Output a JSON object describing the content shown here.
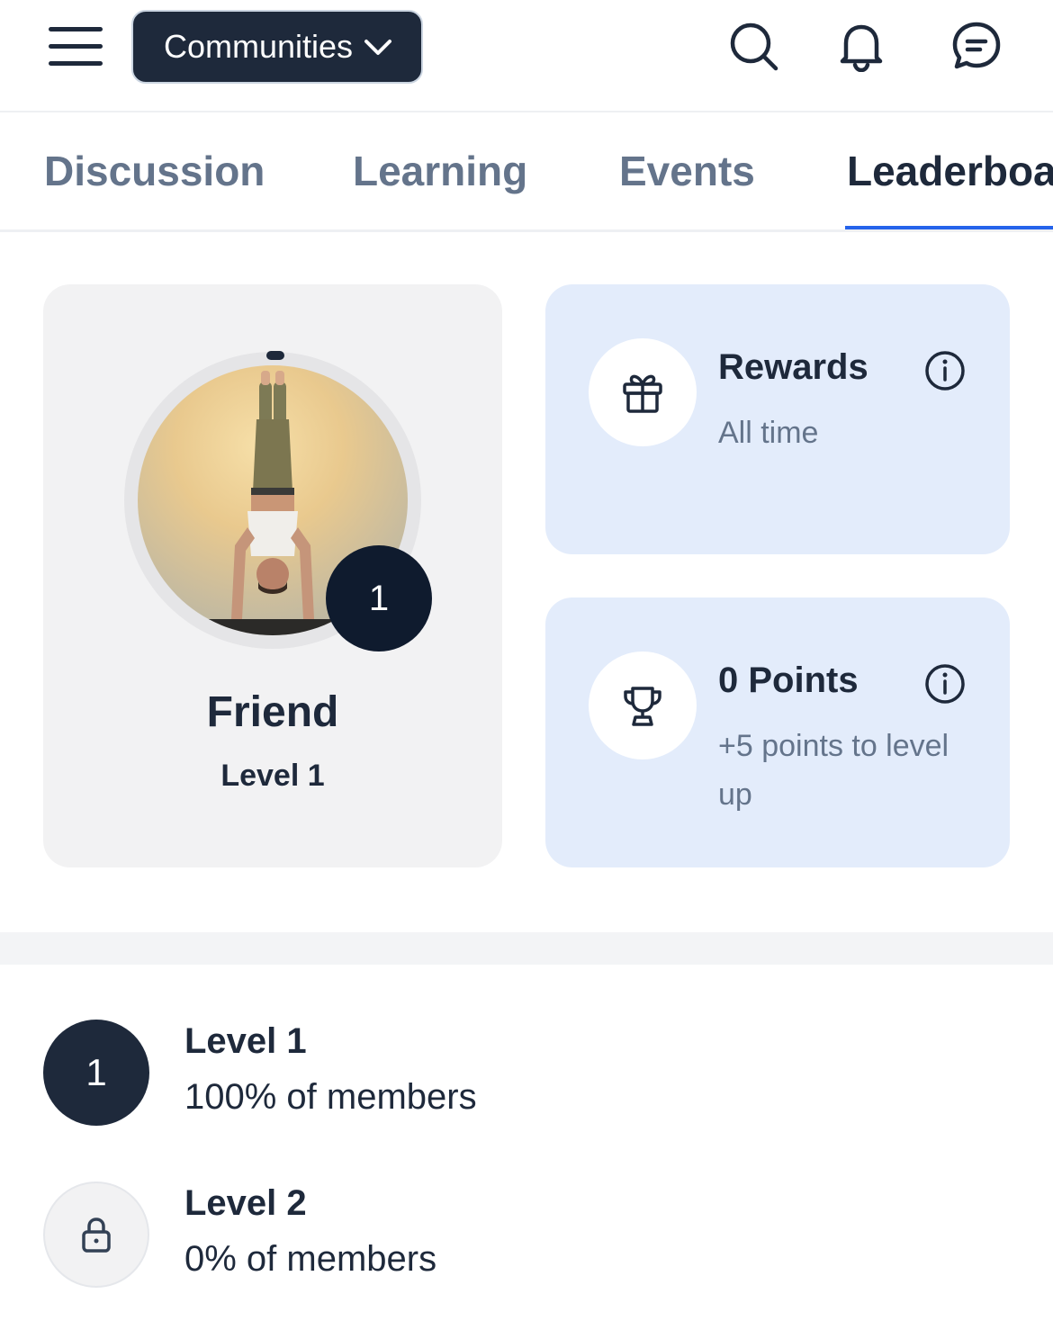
{
  "header": {
    "community_button": "Communities",
    "icons": [
      "menu-icon",
      "chevron-down-icon",
      "search-icon",
      "bell-icon",
      "chat-icon"
    ]
  },
  "tabs": [
    {
      "label": "Discussion",
      "active": false
    },
    {
      "label": "Learning",
      "active": false
    },
    {
      "label": "Events",
      "active": false
    },
    {
      "label": "Leaderboar",
      "active": true
    }
  ],
  "profile": {
    "name": "Friend",
    "level_label": "Level 1",
    "level_number": "1"
  },
  "rewards": {
    "title": "Rewards",
    "subtitle": "All time",
    "icon": "gift-icon"
  },
  "points": {
    "title": "0 Points",
    "subtitle": "+5 points to level up",
    "icon": "trophy-icon"
  },
  "levels": [
    {
      "badge": "1",
      "name": "Level 1",
      "percent": "100% of members",
      "locked": false
    },
    {
      "badge": "",
      "name": "Level 2",
      "percent": "0% of members",
      "locked": true
    }
  ],
  "colors": {
    "primary_dark": "#1e293b",
    "accent_blue": "#2563eb",
    "card_blue": "#e3ecfb",
    "card_gray": "#f2f2f3"
  }
}
